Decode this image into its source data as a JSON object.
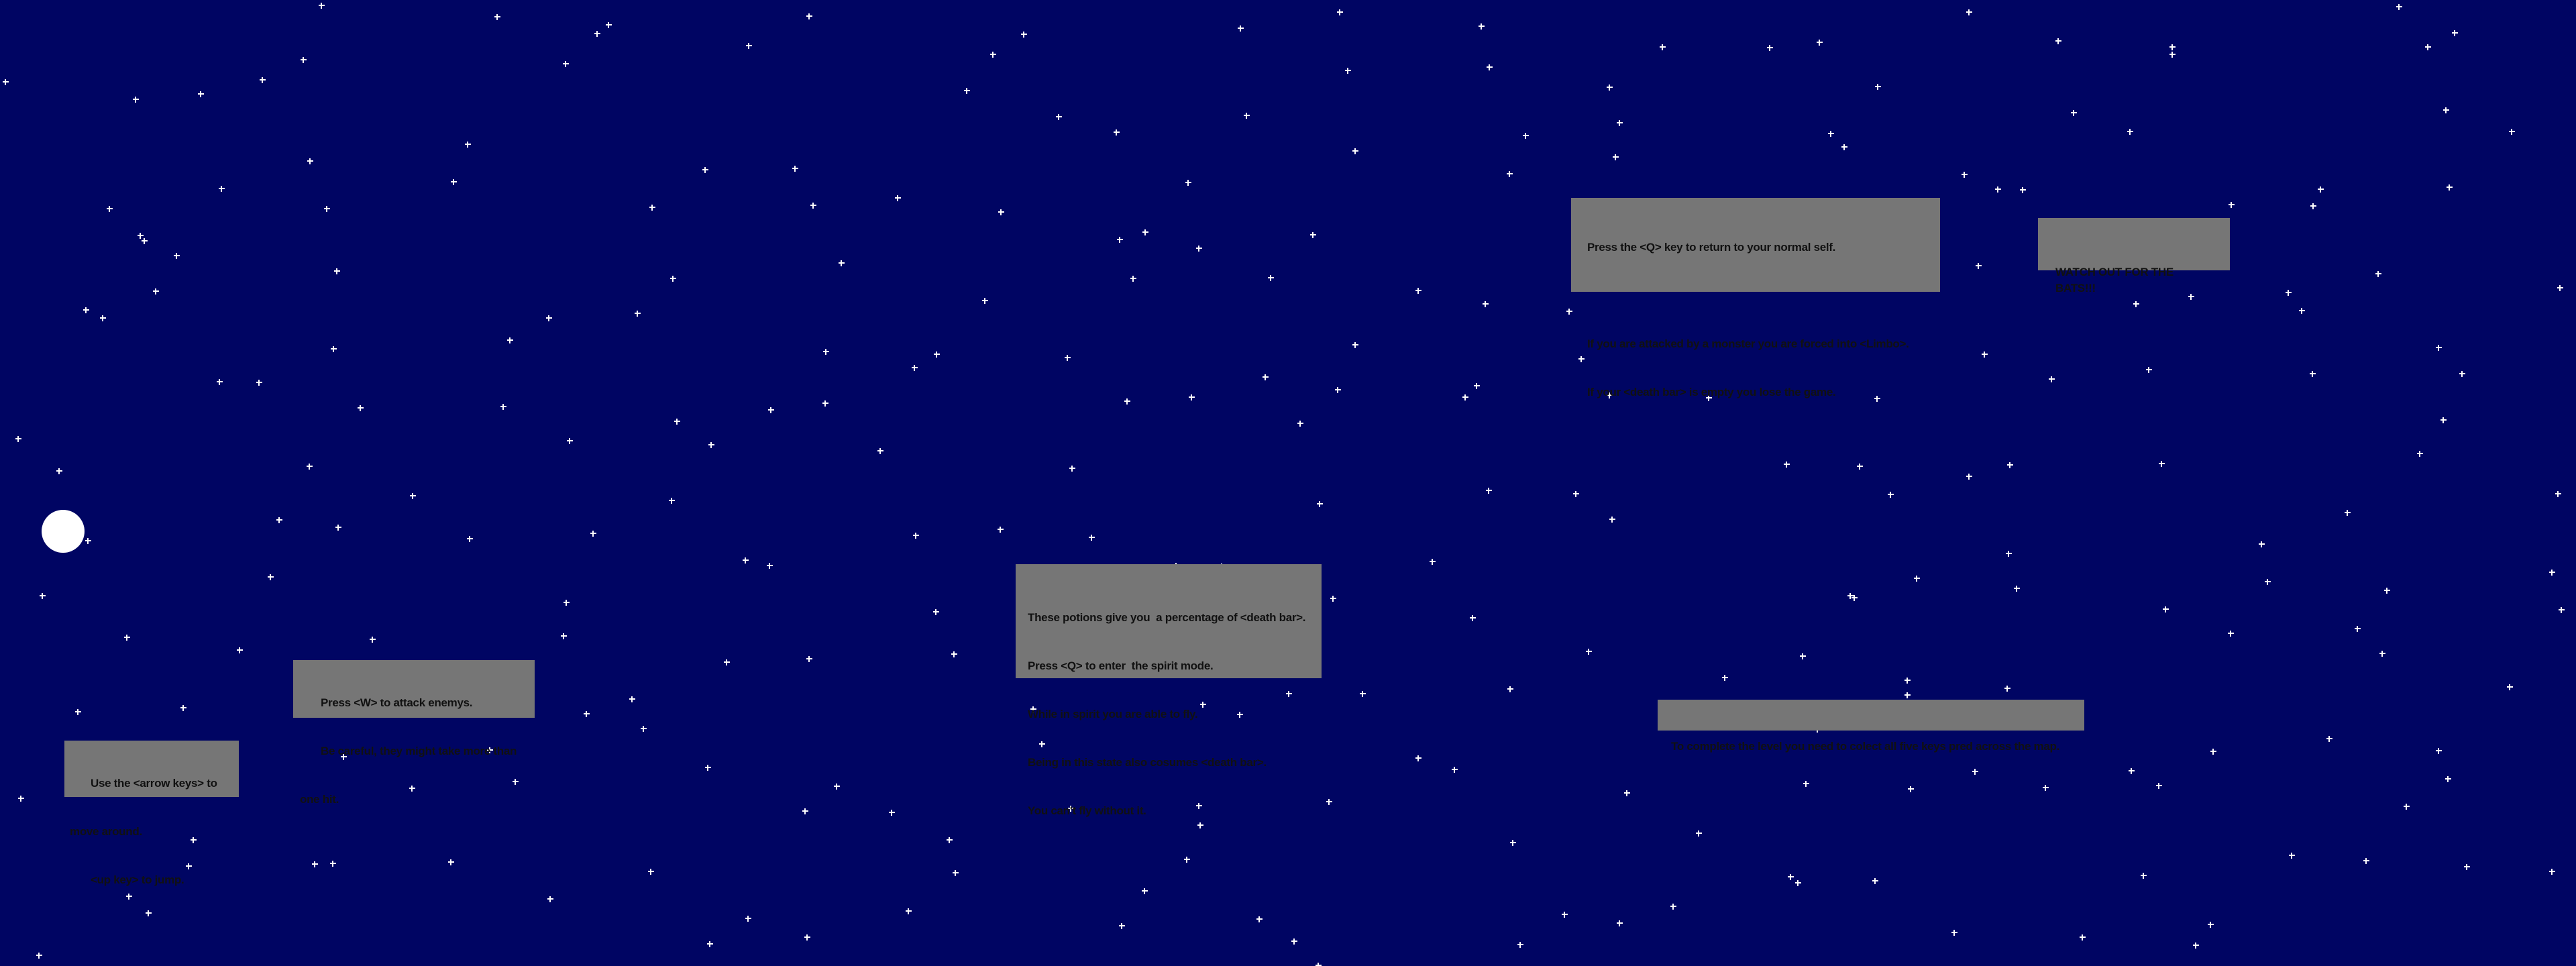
{
  "scene": {
    "background_color": "#000563",
    "star_color": "#ffffff",
    "sign_color": "#767676",
    "text_color": "#111111"
  },
  "player": {
    "shape": "white-circle",
    "color": "#ffffff"
  },
  "signs": {
    "movement": {
      "lines": [
        "       Use the <arrow keys> to",
        "move around.",
        "       <up key> to jump."
      ]
    },
    "attack": {
      "lines": [
        "       Press <W> to attack enemys.",
        "       Be careful, they might take more than",
        "one hit."
      ]
    },
    "potions": {
      "lines": [
        "These potions give you  a percentage of <death bar>.",
        "Press <Q> to enter  the spirit mode.",
        "While in spirit you are able to fly.",
        "Being in this state also cosumes <death bar>.",
        "You can't fly without it."
      ]
    },
    "limbo": {
      "lines": [
        "Press the <Q> key to return to your normal self.",
        "",
        "If you are attacked by a monster you are forced into <Limbo>.",
        "If your <death bar> is empty you lose the game."
      ]
    },
    "bats": {
      "lines": [
        "WATCH OUT FOR THE BATS!!!"
      ]
    },
    "keys": {
      "lines": [
        "To complete the level you need to colect all five keys pred across the map."
      ]
    }
  }
}
